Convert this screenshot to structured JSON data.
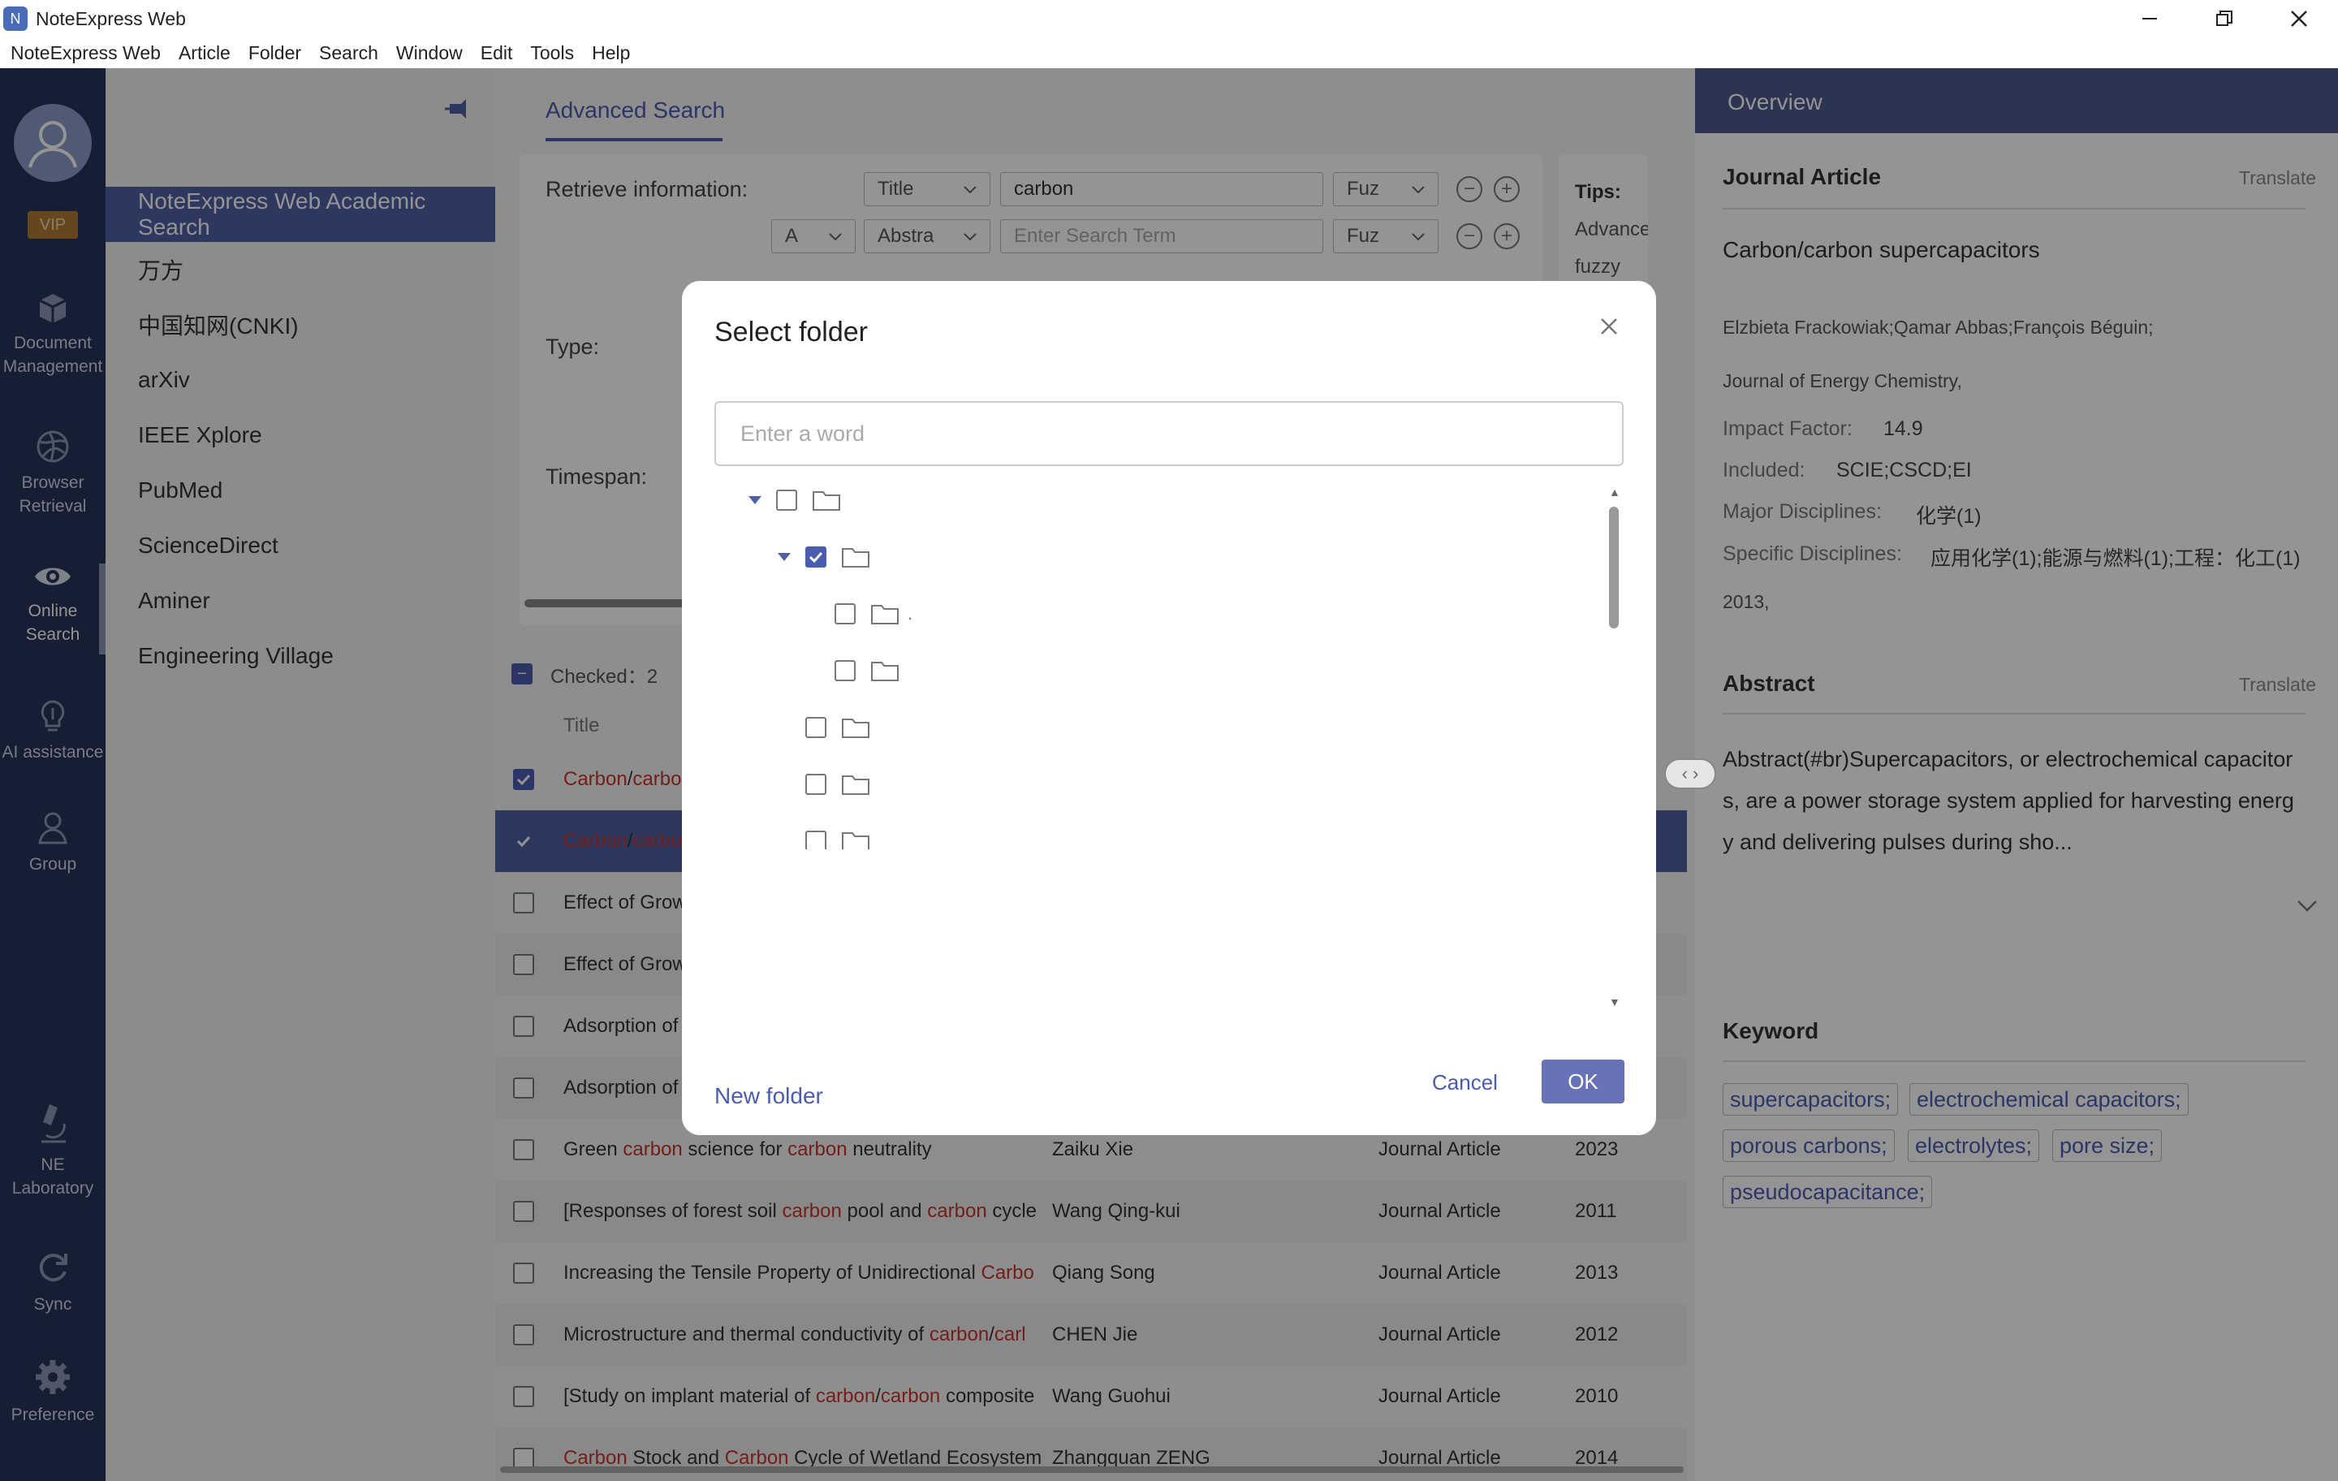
{
  "window": {
    "title": "NoteExpress Web"
  },
  "menu": [
    "NoteExpress Web",
    "Article",
    "Folder",
    "Search",
    "Window",
    "Edit",
    "Tools",
    "Help"
  ],
  "rail": {
    "vip": "VIP",
    "items": [
      {
        "label1": "Document",
        "label2": "Management",
        "icon": "cube-icon"
      },
      {
        "label1": "Browser",
        "label2": "Retrieval",
        "icon": "globe-icon"
      },
      {
        "label1": "Online",
        "label2": "Search",
        "icon": "eye-icon"
      },
      {
        "label1": "AI assistance",
        "label2": "",
        "icon": "bulb-icon"
      },
      {
        "label1": "Group",
        "label2": "",
        "icon": "group-icon"
      },
      {
        "label1": "NE",
        "label2": "Laboratory",
        "icon": "microscope-icon"
      },
      {
        "label1": "Sync",
        "label2": "",
        "icon": "sync-icon"
      },
      {
        "label1": "Preference",
        "label2": "",
        "icon": "gear-icon"
      }
    ]
  },
  "sources": [
    "NoteExpress Web Academic Search",
    "万方",
    "中国知网(CNKI)",
    "arXiv",
    "IEEE Xplore",
    "PubMed",
    "ScienceDirect",
    "Aminer",
    "Engineering Village"
  ],
  "search": {
    "tab": "Advanced Search",
    "retrieve_label": "Retrieve information:",
    "field1": "Title",
    "term1": "carbon",
    "match1": "Fuz",
    "logic2": "A",
    "field2": "Abstra",
    "term2_placeholder": "Enter Search Term",
    "match2": "Fuz",
    "type_label": "Type:",
    "timespan_label": "Timespan:",
    "tips_label": "Tips:",
    "tips_line1": "Advance",
    "tips_line2": "fuzzy ma"
  },
  "results": {
    "checked": "Checked：2",
    "col_title": "Title",
    "rows": [
      {
        "parts": [
          [
            "Carbon",
            true
          ],
          [
            "/",
            false
          ],
          [
            "carbo",
            true
          ]
        ],
        "author": "",
        "type": "",
        "year": "",
        "checked": true,
        "selected": false
      },
      {
        "parts": [
          [
            "Carbon",
            true
          ],
          [
            "/",
            false
          ],
          [
            "carbo",
            true
          ]
        ],
        "author": "",
        "type": "",
        "year": "",
        "checked": true,
        "selected": true
      },
      {
        "parts": [
          [
            "Effect of Grow",
            false
          ]
        ],
        "author": "",
        "type": "",
        "year": "",
        "checked": false,
        "selected": false
      },
      {
        "parts": [
          [
            "Effect of Grow",
            false
          ]
        ],
        "author": "",
        "type": "",
        "year": "",
        "checked": false,
        "selected": false
      },
      {
        "parts": [
          [
            "Adsorption of",
            false
          ]
        ],
        "author": "",
        "type": "",
        "year": "",
        "checked": false,
        "selected": false
      },
      {
        "parts": [
          [
            "Adsorption of",
            false
          ]
        ],
        "author": "",
        "type": "",
        "year": "",
        "checked": false,
        "selected": false
      },
      {
        "parts": [
          [
            "Green ",
            false
          ],
          [
            "carbon",
            true
          ],
          [
            " science for ",
            false
          ],
          [
            "carbon",
            true
          ],
          [
            " neutrality",
            false
          ]
        ],
        "author": "Zaiku Xie",
        "type": "Journal Article",
        "year": "2023",
        "checked": false,
        "selected": false
      },
      {
        "parts": [
          [
            "[Responses of forest soil ",
            false
          ],
          [
            "carbon",
            true
          ],
          [
            " pool and ",
            false
          ],
          [
            "carbon",
            true
          ],
          [
            " cycle",
            false
          ]
        ],
        "author": "Wang Qing-kui",
        "type": "Journal Article",
        "year": "2011",
        "checked": false,
        "selected": false
      },
      {
        "parts": [
          [
            "Increasing the Tensile Property of Unidirectional ",
            false
          ],
          [
            "Carbo",
            true
          ]
        ],
        "author": "Qiang Song",
        "type": "Journal Article",
        "year": "2013",
        "checked": false,
        "selected": false
      },
      {
        "parts": [
          [
            "Microstructure and thermal conductivity of ",
            false
          ],
          [
            "carbon",
            true
          ],
          [
            "/",
            false
          ],
          [
            "carl",
            true
          ]
        ],
        "author": "CHEN Jie",
        "type": "Journal Article",
        "year": "2012",
        "checked": false,
        "selected": false
      },
      {
        "parts": [
          [
            "[Study on implant material of ",
            false
          ],
          [
            "carbon",
            true
          ],
          [
            "/",
            false
          ],
          [
            "carbon",
            true
          ],
          [
            " composite",
            false
          ]
        ],
        "author": "Wang Guohui",
        "type": "Journal Article",
        "year": "2010",
        "checked": false,
        "selected": false
      },
      {
        "parts": [
          [
            "Carbon",
            true
          ],
          [
            " Stock and ",
            false
          ],
          [
            "Carbon",
            true
          ],
          [
            " Cycle of Wetland Ecosystem",
            false
          ]
        ],
        "author": "Zhangquan ZENG",
        "type": "Journal Article",
        "year": "2014",
        "checked": false,
        "selected": false
      }
    ]
  },
  "overview": {
    "tab": "Overview",
    "type": "Journal Article",
    "translate": "Translate",
    "title": "Carbon/carbon supercapacitors",
    "authors": "Elzbieta Frackowiak;Qamar Abbas;François Béguin;",
    "journal": "Journal of Energy Chemistry,",
    "impact_label": "Impact Factor:",
    "impact": "14.9",
    "included_label": "Included:",
    "included": "SCIE;CSCD;EI",
    "major_label": "Major Disciplines:",
    "major": "化学(1)",
    "specific_label": "Specific Disciplines:",
    "specific": "应用化学(1);能源与燃料(1);工程：化工(1)",
    "year": "2013,",
    "abstract_label": "Abstract",
    "abstract_l1": "Abstract(#br)Supercapacitors, or electrochemical capacitor",
    "abstract_l2": "s, are a power storage system applied for harvesting energ",
    "abstract_l3": "y and delivering pulses during sho...",
    "keyword_label": "Keyword",
    "keywords": [
      "supercapacitors;",
      "electrochemical capacitors;",
      "porous carbons;",
      "electrolytes;",
      "pore size;",
      "pseudocapacitance;"
    ]
  },
  "dialog": {
    "title": "Select folder",
    "search_placeholder": "Enter a word",
    "new_folder": "New folder",
    "cancel": "Cancel",
    "ok": "OK",
    "tree": [
      {
        "level": 0,
        "expanded": true,
        "checked": false,
        "label": ""
      },
      {
        "level": 1,
        "expanded": true,
        "checked": true,
        "label": ""
      },
      {
        "level": 2,
        "expanded": null,
        "checked": false,
        "label": "."
      },
      {
        "level": 2,
        "expanded": null,
        "checked": false,
        "label": ""
      },
      {
        "level": 1,
        "expanded": null,
        "checked": false,
        "label": ""
      },
      {
        "level": 1,
        "expanded": null,
        "checked": false,
        "label": ""
      },
      {
        "level": 1,
        "expanded": null,
        "checked": false,
        "label": ""
      },
      {
        "level": 1,
        "expanded": true,
        "checked": false,
        "label": ""
      },
      {
        "level": 2,
        "expanded": null,
        "checked": false,
        "label": ""
      }
    ]
  },
  "colors": {
    "accent": "#4a5cb0",
    "rail": "#26345a",
    "highlight": "#c8342b",
    "ok_button": "#6872b8"
  }
}
